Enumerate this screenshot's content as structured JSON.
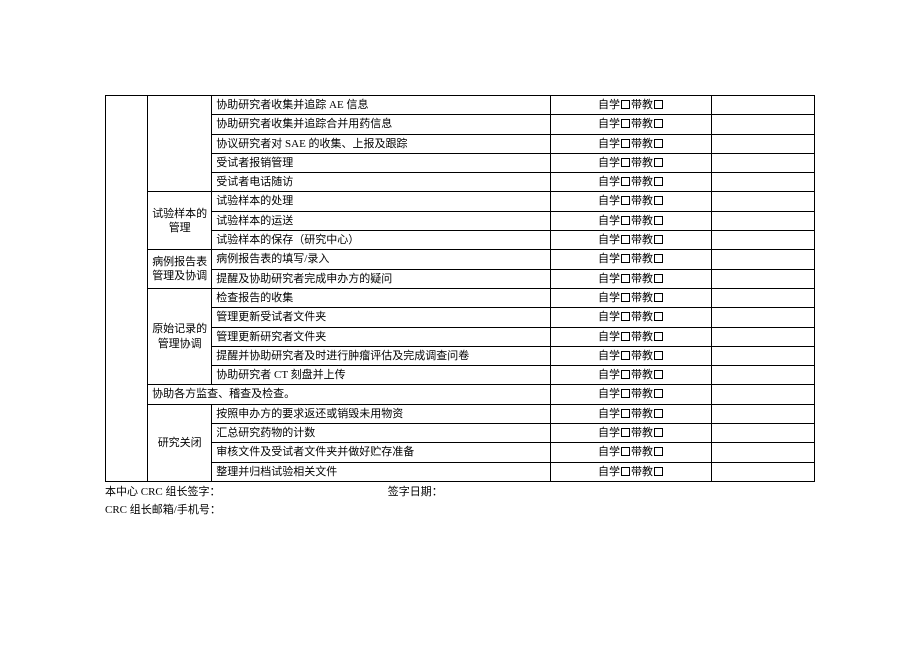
{
  "checkboxLabels": {
    "self": "自学",
    "tutor": "带教"
  },
  "sections": [
    {
      "category": "",
      "rows": [
        "协助研究者收集并追踪 AE 信息",
        "协助研究者收集并追踪合并用药信息",
        "协议研究者对 SAE 的收集、上报及跟踪",
        "受试者报销管理",
        "受试者电话随访"
      ]
    },
    {
      "category": "试验样本的管理",
      "rows": [
        "试验样本的处理",
        "试验样本的运送",
        "试验样本的保存（研究中心）"
      ]
    },
    {
      "category": "病例报告表管理及协调",
      "rows": [
        "病例报告表的填写/录入",
        "提醒及协助研究者完成申办方的疑问"
      ]
    },
    {
      "category": "原始记录的管理协调",
      "rows": [
        "检查报告的收集",
        "管理更新受试者文件夹",
        "管理更新研究者文件夹",
        "提醒并协助研究者及时进行肿瘤评估及完成调查问卷",
        "协助研究者 CT 刻盘并上传"
      ]
    },
    {
      "spanFull": true,
      "text": "协助各方监查、稽查及检查。"
    },
    {
      "category": "研究关闭",
      "rows": [
        "按照申办方的要求返还或销毁未用物资",
        "汇总研究药物的计数",
        "审核文件及受试者文件夹并做好贮存准备",
        "整理并归档试验相关文件"
      ]
    }
  ],
  "footer": {
    "line1a": "本中心 CRC 组长签字：",
    "line1b": "签字日期：",
    "line2": "CRC 组长邮箱/手机号："
  }
}
